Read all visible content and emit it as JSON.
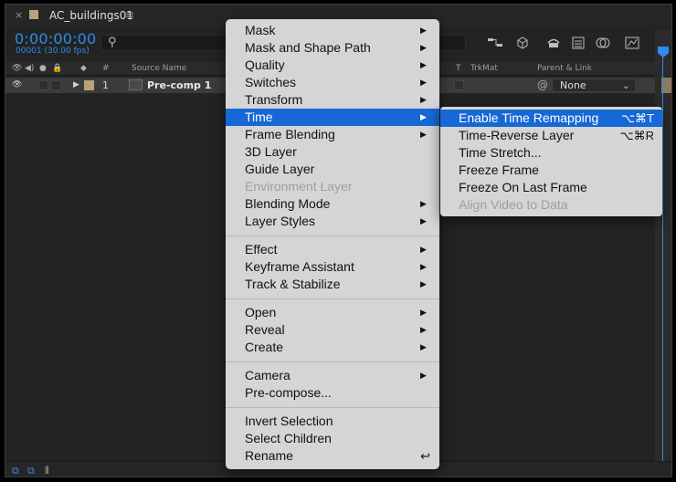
{
  "tab": {
    "close": "×",
    "title": "AC_buildings01",
    "menu": "≡"
  },
  "timecode": {
    "time": "0:00:00:00",
    "frame_info": "00001 (30.00 fps)"
  },
  "search": {
    "placeholder": "",
    "icon": "search-icon"
  },
  "header": {
    "number": "#",
    "source_name": "Source Name",
    "t": "T",
    "trkmat": "TrkMat",
    "parent_link": "Parent & Link"
  },
  "layer": {
    "number": "1",
    "name": "Pre-comp 1",
    "parent": "None",
    "label_color": "#b9a27a"
  },
  "colors": {
    "accent": "#2d8ceb",
    "menu_highlight": "#1568d6",
    "menu_bg": "#d5d5d5"
  },
  "menu": {
    "items": [
      {
        "label": "Mask",
        "arrow": "▶",
        "enabled": true
      },
      {
        "label": "Mask and Shape Path",
        "arrow": "▶",
        "enabled": true
      },
      {
        "label": "Quality",
        "arrow": "▶",
        "enabled": true
      },
      {
        "label": "Switches",
        "arrow": "▶",
        "enabled": true
      },
      {
        "label": "Transform",
        "arrow": "▶",
        "enabled": true
      },
      {
        "label": "Time",
        "arrow": "▶",
        "enabled": true,
        "selected": true
      },
      {
        "label": "Frame Blending",
        "arrow": "▶",
        "enabled": true
      },
      {
        "label": "3D Layer",
        "enabled": true
      },
      {
        "label": "Guide Layer",
        "enabled": true
      },
      {
        "label": "Environment Layer",
        "enabled": false
      },
      {
        "label": "Blending Mode",
        "arrow": "▶",
        "enabled": true
      },
      {
        "label": "Layer Styles",
        "arrow": "▶",
        "enabled": true
      },
      {
        "label": "Effect",
        "arrow": "▶",
        "enabled": true
      },
      {
        "label": "Keyframe Assistant",
        "arrow": "▶",
        "enabled": true
      },
      {
        "label": "Track & Stabilize",
        "arrow": "▶",
        "enabled": true
      },
      {
        "label": "Open",
        "arrow": "▶",
        "enabled": true
      },
      {
        "label": "Reveal",
        "arrow": "▶",
        "enabled": true
      },
      {
        "label": "Create",
        "arrow": "▶",
        "enabled": true
      },
      {
        "label": "Camera",
        "arrow": "▶",
        "enabled": true
      },
      {
        "label": "Pre-compose...",
        "enabled": true
      },
      {
        "label": "Invert Selection",
        "enabled": true
      },
      {
        "label": "Select Children",
        "enabled": true
      },
      {
        "label": "Rename",
        "shortcut": "↩",
        "enabled": true
      }
    ]
  },
  "submenu": {
    "items": [
      {
        "label": "Enable Time Remapping",
        "shortcut": "⌥⌘T",
        "enabled": true,
        "selected": true
      },
      {
        "label": "Time-Reverse Layer",
        "shortcut": "⌥⌘R",
        "enabled": true
      },
      {
        "label": "Time Stretch...",
        "enabled": true
      },
      {
        "label": "Freeze Frame",
        "enabled": true
      },
      {
        "label": "Freeze On Last Frame",
        "enabled": true
      },
      {
        "label": "Align Video to Data",
        "enabled": false
      }
    ]
  }
}
